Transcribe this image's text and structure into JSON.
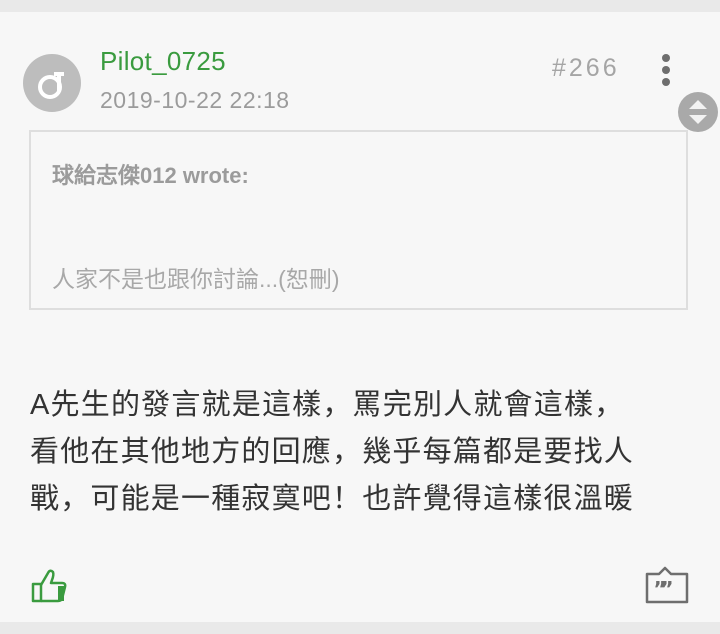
{
  "post": {
    "author": "Pilot_0725",
    "timestamp": "2019-10-22 22:18",
    "floor": "#266",
    "quote": {
      "author": "球給志傑012 wrote:",
      "text": "人家不是也跟你討論...(恕刪)"
    },
    "body_lines": [
      "A先生的發言就是這樣，罵完別人就會這樣，",
      "看他在其他地方的回應，幾乎每篇都是要找人",
      "戰，可能是一種寂寞吧！也許覺得這樣很溫暖"
    ]
  },
  "icons": {
    "avatar": "default-avatar-icon",
    "more": "more-vertical-icon",
    "scroll": "scroll-up-down-icon",
    "like": "thumbs-up-icon",
    "quote_reply": "quote-reply-icon"
  },
  "colors": {
    "username": "#3a9b3f",
    "like_icon": "#3a9b3f",
    "muted_text": "#9b9b9b",
    "body_text": "#333333",
    "card_bg": "#f7f7f7"
  }
}
